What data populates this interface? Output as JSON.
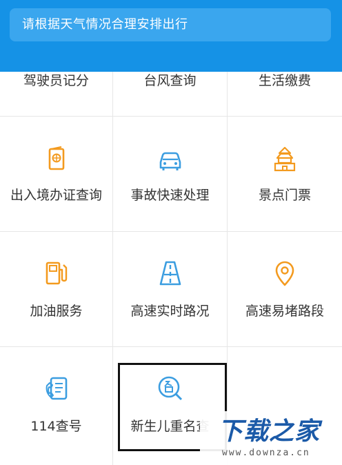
{
  "notice": {
    "text": "请根据天气情况合理安排出行"
  },
  "services": [
    {
      "label": "驾驶员记分",
      "icon": "driver-points-icon"
    },
    {
      "label": "台风查询",
      "icon": "typhoon-icon"
    },
    {
      "label": "生活缴费",
      "icon": "bill-payment-icon"
    },
    {
      "label": "出入境办证查询",
      "icon": "passport-icon"
    },
    {
      "label": "事故快速处理",
      "icon": "car-accident-icon"
    },
    {
      "label": "景点门票",
      "icon": "temple-icon"
    },
    {
      "label": "加油服务",
      "icon": "fuel-pump-icon"
    },
    {
      "label": "高速实时路况",
      "icon": "highway-icon"
    },
    {
      "label": "高速易堵路段",
      "icon": "location-pin-icon"
    },
    {
      "label": "114查号",
      "icon": "phone-book-icon"
    },
    {
      "label": "新生儿重名查",
      "icon": "name-search-icon"
    }
  ],
  "watermark": {
    "title": "下载之家",
    "url": "www.downza.cn"
  },
  "colors": {
    "header": "#1592e6",
    "orange": "#f39a1e",
    "blue": "#3b9de0",
    "watermark": "#1b5aa8"
  }
}
